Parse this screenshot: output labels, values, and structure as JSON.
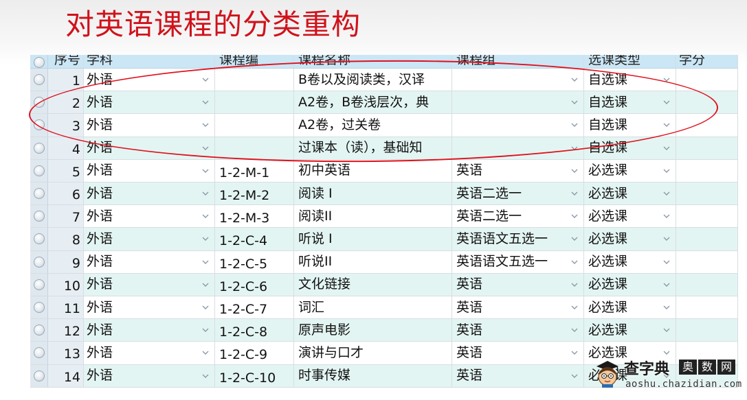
{
  "slide": {
    "title": "对英语课程的分类重构"
  },
  "table": {
    "headers": [
      "序号",
      "学科",
      "课程编",
      "课程名称",
      "课程组",
      "选课类型",
      "学分"
    ],
    "row_colors": [
      "#ffffff",
      "#e3f5f2"
    ],
    "rows": [
      {
        "no": "1",
        "subject": "外语",
        "code": "",
        "name": "B卷以及阅读类，汉译",
        "group": "",
        "type": "自选课"
      },
      {
        "no": "2",
        "subject": "外语",
        "code": "",
        "name": "A2卷，B卷浅层次，典",
        "group": "",
        "type": "自选课"
      },
      {
        "no": "3",
        "subject": "外语",
        "code": "",
        "name": "A2卷，过关卷",
        "group": "",
        "type": "自选课"
      },
      {
        "no": "4",
        "subject": "外语",
        "code": "",
        "name": "过课本（读），基础知",
        "group": "",
        "type": "自选课"
      },
      {
        "no": "5",
        "subject": "外语",
        "code": "1-2-M-1",
        "name": "初中英语",
        "group": "英语",
        "type": "必选课"
      },
      {
        "no": "6",
        "subject": "外语",
        "code": "1-2-M-2",
        "name": "阅读 I",
        "group": "英语二选一",
        "type": "必选课"
      },
      {
        "no": "7",
        "subject": "外语",
        "code": "1-2-M-3",
        "name": "阅读II",
        "group": "英语二选一",
        "type": "必选课"
      },
      {
        "no": "8",
        "subject": "外语",
        "code": "1-2-C-4",
        "name": "听说 I",
        "group": "英语语文五选一",
        "type": "必选课"
      },
      {
        "no": "9",
        "subject": "外语",
        "code": "1-2-C-5",
        "name": "听说II",
        "group": "英语语文五选一",
        "type": "必选课"
      },
      {
        "no": "10",
        "subject": "外语",
        "code": "1-2-C-6",
        "name": "文化链接",
        "group": "英语",
        "type": "必选课"
      },
      {
        "no": "11",
        "subject": "外语",
        "code": "1-2-C-7",
        "name": "词汇",
        "group": "英语",
        "type": "必选课"
      },
      {
        "no": "12",
        "subject": "外语",
        "code": "1-2-C-8",
        "name": "原声电影",
        "group": "英语",
        "type": "必选课"
      },
      {
        "no": "13",
        "subject": "外语",
        "code": "1-2-C-9",
        "name": "演讲与口才",
        "group": "英语",
        "type": "必选课"
      },
      {
        "no": "14",
        "subject": "外语",
        "code": "1-2-C-10",
        "name": "时事传媒",
        "group": "英语",
        "type": "必选课"
      }
    ]
  },
  "watermark": {
    "brand": "查字典",
    "boxed": [
      "奥",
      "数",
      "网"
    ],
    "url": "aoshu.chazidian.com"
  },
  "colors": {
    "title": "#d0121b",
    "annotation": "#e0101c",
    "header_bg": "#cbe6f5"
  },
  "icons": {
    "row_selector": "radio-circle-icon",
    "dropdown": "chevron-down-icon"
  }
}
